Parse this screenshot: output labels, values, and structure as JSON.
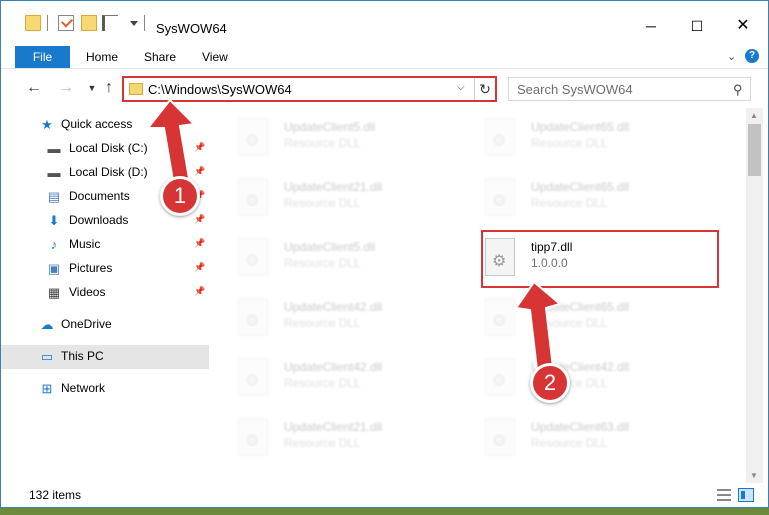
{
  "window": {
    "title": "SysWOW64",
    "minimize_label": "─",
    "maximize_label": "☐",
    "close_label": "✕"
  },
  "ribbon": {
    "tabs": [
      {
        "label": "File"
      },
      {
        "label": "Home"
      },
      {
        "label": "Share"
      },
      {
        "label": "View"
      }
    ],
    "help_label": "?"
  },
  "address": {
    "path": "C:\\Windows\\SysWOW64",
    "search_placeholder": "Search SysWOW64"
  },
  "nav": {
    "items": [
      {
        "label": "Quick access",
        "icon": "star-icon",
        "glyph": "★",
        "color": "#1979ca"
      },
      {
        "label": "Local Disk (C:)",
        "icon": "drive-icon",
        "glyph": "▬",
        "color": "#555555",
        "pinned": true
      },
      {
        "label": "Local Disk (D:)",
        "icon": "drive-icon",
        "glyph": "▬",
        "color": "#555555",
        "pinned": true
      },
      {
        "label": "Documents",
        "icon": "documents-icon",
        "glyph": "▤",
        "color": "#4a7fc1",
        "pinned": true
      },
      {
        "label": "Downloads",
        "icon": "download-icon",
        "glyph": "⬇",
        "color": "#1979ca",
        "pinned": true
      },
      {
        "label": "Music",
        "icon": "music-icon",
        "glyph": "♪",
        "color": "#1979ca",
        "pinned": true
      },
      {
        "label": "Pictures",
        "icon": "pictures-icon",
        "glyph": "▣",
        "color": "#4a7fc1",
        "pinned": true
      },
      {
        "label": "Videos",
        "icon": "videos-icon",
        "glyph": "▦",
        "color": "#444444",
        "pinned": true
      },
      {
        "label": "OneDrive",
        "icon": "cloud-icon",
        "glyph": "☁",
        "color": "#1979ca"
      },
      {
        "label": "This PC",
        "icon": "computer-icon",
        "glyph": "▭",
        "color": "#1979ca",
        "selected": true
      },
      {
        "label": "Network",
        "icon": "network-icon",
        "glyph": "⊞",
        "color": "#1979ca"
      }
    ]
  },
  "files": {
    "left_column": [
      {
        "name": "UpdateClient5.dll",
        "desc": "Resource DLL"
      },
      {
        "name": "UpdateClient21.dll",
        "desc": "Resource DLL"
      },
      {
        "name": "UpdateClient5.dll",
        "desc": "Resource DLL"
      },
      {
        "name": "UpdateClient42.dll",
        "desc": "Resource DLL"
      },
      {
        "name": "UpdateClient42.dll",
        "desc": "Resource DLL"
      },
      {
        "name": "UpdateClient21.dll",
        "desc": "Resource DLL"
      }
    ],
    "right_column": [
      {
        "name": "UpdateClient65.dll",
        "desc": "Resource DLL"
      },
      {
        "name": "UpdateClient65.dll",
        "desc": "Resource DLL"
      },
      {
        "name": "tipp7.dll",
        "desc": "1.0.0.0",
        "highlighted": true
      },
      {
        "name": "UpdateClient65.dll",
        "desc": "Resource DLL"
      },
      {
        "name": "UpdateClient42.dll",
        "desc": "Resource DLL"
      },
      {
        "name": "UpdateClient63.dll",
        "desc": "Resource DLL"
      }
    ]
  },
  "status": {
    "item_count": "132 items"
  },
  "annotations": {
    "step1": "1",
    "step2": "2",
    "color": "#d73535"
  }
}
